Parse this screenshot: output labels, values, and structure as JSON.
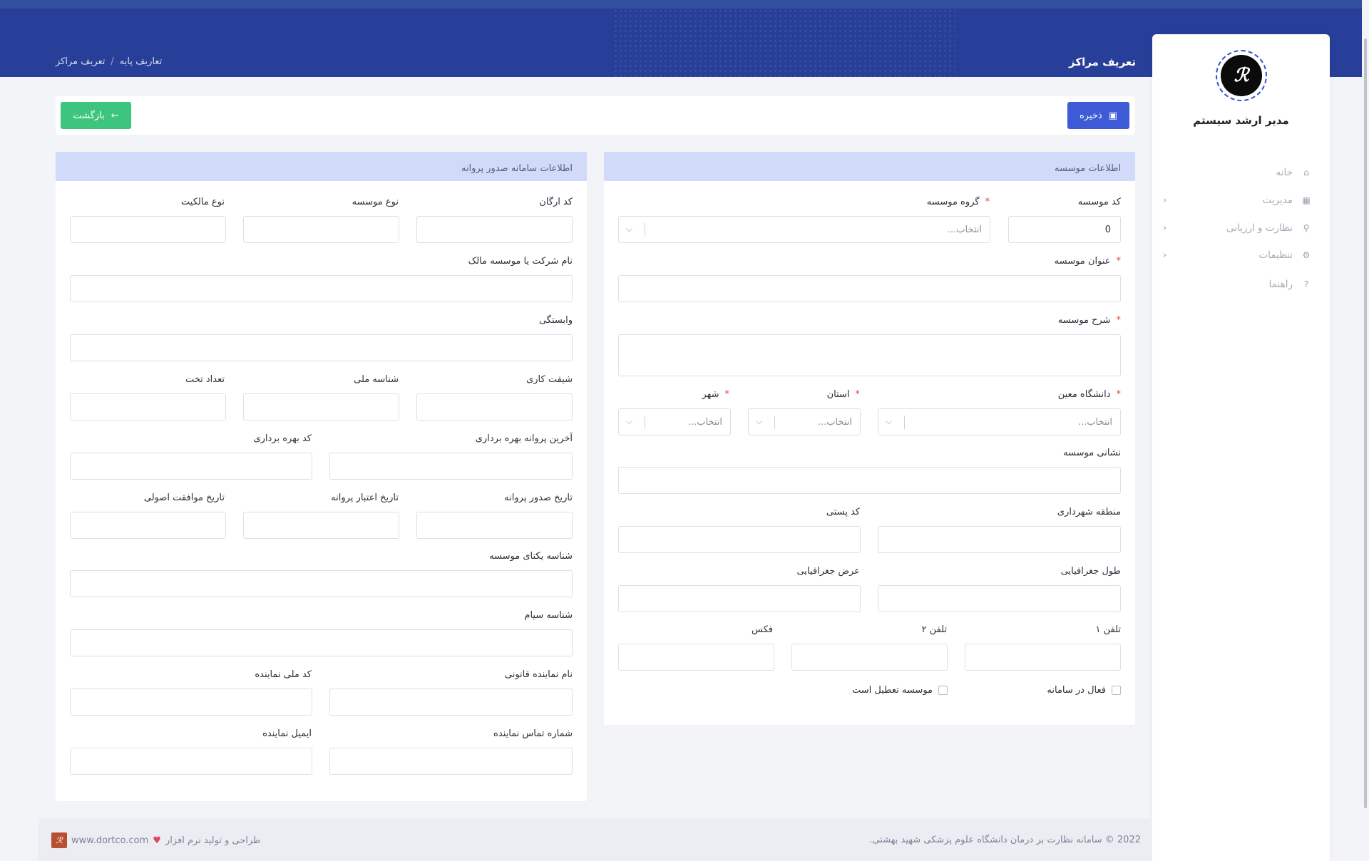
{
  "header": {
    "page_title": "تعریف مراکز",
    "breadcrumb": [
      "تعاریف پایه",
      "تعریف مراکز"
    ]
  },
  "sidebar": {
    "logo_text": "ℛ",
    "user_name": "مدیر ارشد سیستم",
    "items": [
      {
        "label": "خانه",
        "icon": "home-icon"
      },
      {
        "label": "مدیریت",
        "icon": "grid-icon"
      },
      {
        "label": "نظارت و ارزیابی",
        "icon": "user-check-icon"
      },
      {
        "label": "تنظیمات",
        "icon": "gear-icon"
      },
      {
        "label": "راهنما",
        "icon": "question-icon"
      }
    ]
  },
  "toolbar": {
    "save_label": "ذخیره",
    "back_label": "بازگشت"
  },
  "institute": {
    "title": "اطلاعات موسسه",
    "code_label": "کد موسسه",
    "code_value": "0",
    "group_label": "گروه موسسه",
    "group_placeholder": "انتخاب...",
    "name_label": "عنوان موسسه",
    "desc_label": "شرح موسسه",
    "university_label": "دانشگاه معین",
    "university_placeholder": "انتخاب...",
    "province_label": "استان",
    "province_placeholder": "انتخاب...",
    "city_label": "شهر",
    "city_placeholder": "انتخاب...",
    "address_label": "نشانی موسسه",
    "district_label": "منطقه شهرداری",
    "postal_label": "کد پستی",
    "longitude_label": "طول جغرافیایی",
    "latitude_label": "عرض جغرافیایی",
    "phone1_label": "تلفن ۱",
    "phone2_label": "تلفن ۲",
    "fax_label": "فکس",
    "active_label": "فعال در سامانه",
    "closed_label": "موسسه تعطیل است"
  },
  "license": {
    "title": "اطلاعات سامانه صدور پروانه",
    "org_code_label": "کد ارگان",
    "inst_type_label": "نوع موسسه",
    "ownership_label": "نوع مالکیت",
    "owner_label": "نام شرکت یا موسسه مالک",
    "affiliation_label": "وابستگی",
    "shift_label": "شیفت کاری",
    "national_id_label": "شناسه ملی",
    "beds_label": "تعداد تخت",
    "last_permit_label": "آخرین پروانه بهره برداری",
    "operation_code_label": "کد بهره برداری",
    "issue_date_label": "تاریخ صدور پروانه",
    "validity_date_label": "تاریخ اعتبار پروانه",
    "approval_date_label": "تاریخ موافقت اصولی",
    "unique_id_label": "شناسه یکتای موسسه",
    "siam_label": "شناسه سیام",
    "rep_name_label": "نام نماینده قانونی",
    "rep_national_label": "کد ملی نماینده",
    "rep_phone_label": "شماره تماس نماینده",
    "rep_email_label": "ایمیل نماینده"
  },
  "footer": {
    "copyright": "2022 © سامانه نظارت بر درمان دانشگاه علوم پزشکی شهید بهشتی.",
    "credit": "طراحی و تولید نرم افزار",
    "site": "www.dortco.com",
    "logo_text": "ℛ"
  }
}
